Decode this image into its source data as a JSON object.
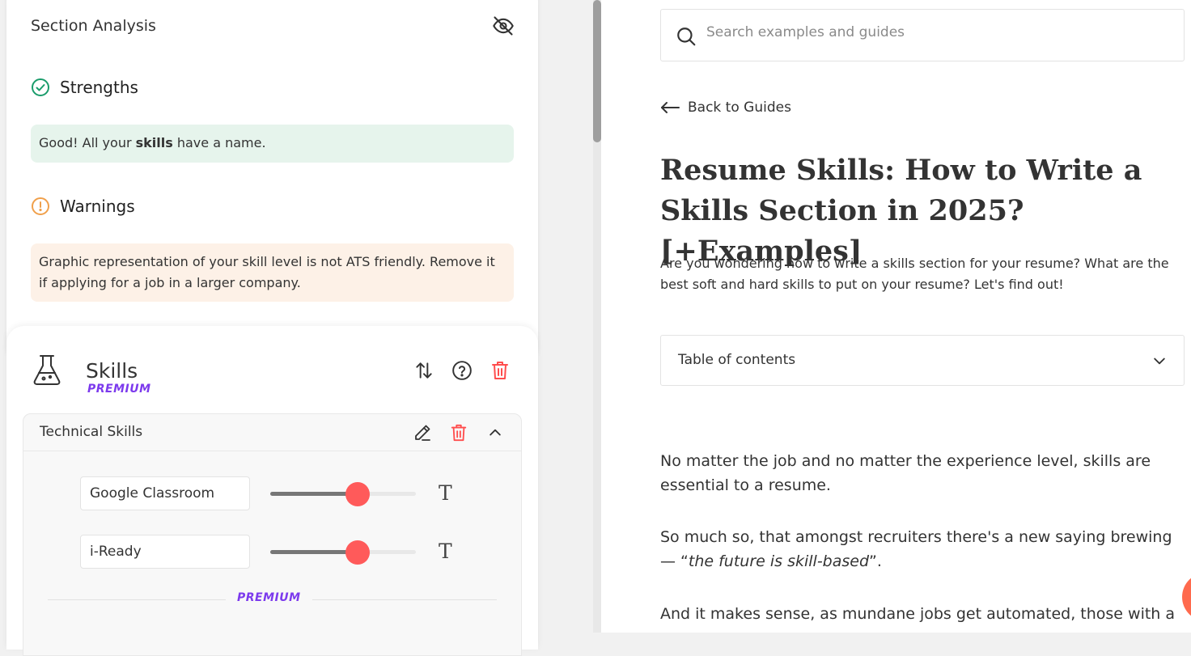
{
  "analysis": {
    "title": "Section Analysis",
    "strengths_label": "Strengths",
    "strength_text_before": "Good! All your ",
    "strength_text_bold": "skills",
    "strength_text_after": " have a name.",
    "warnings_label": "Warnings",
    "warning_text": "Graphic representation of your skill level is not ATS friendly. Remove it if applying for a job in a larger company."
  },
  "skills": {
    "title": "Skills",
    "premium_label": "PREMIUM",
    "group": {
      "title": "Technical Skills",
      "items": [
        {
          "name": "Google Classroom",
          "level": 0.6
        },
        {
          "name": "i-Ready",
          "level": 0.6
        }
      ],
      "divider_label": "PREMIUM"
    }
  },
  "article": {
    "search_placeholder": "Search examples and guides",
    "back_label": "Back to Guides",
    "title": "Resume Skills: How to Write a Skills Section in 2025? [+Examples]",
    "intro": "Are you wondering how to write a skills section for your resume? What are the best soft and hard skills to put on your resume? Let's find out!",
    "toc_label": "Table of contents",
    "para1": "No matter the job and no matter the experience level, skills are essential to a resume.",
    "para2_before": "So much so, that amongst recruiters there's a new saying brewing — “",
    "para2_italic": "the future is skill-based",
    "para2_after": "”.",
    "para3": "And it makes sense, as mundane jobs get automated, those with a"
  },
  "colors": {
    "accent_red": "#ff5a5a",
    "premium_purple": "#7c3aed",
    "success_green": "#1a9c6b",
    "warning_orange": "#f0a04b"
  }
}
